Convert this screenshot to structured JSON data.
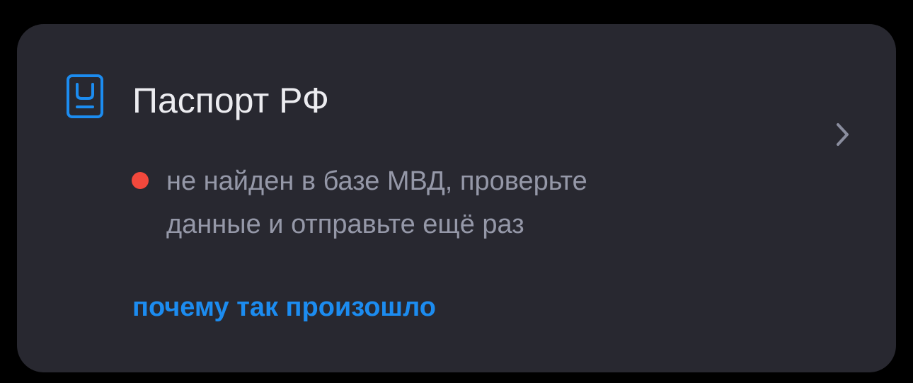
{
  "document_card": {
    "icon": "passport-icon",
    "title": "Паспорт РФ",
    "status": {
      "color": "#F2483C",
      "line1": "не найден в базе МВД, проверьте",
      "line2": "данные и отправьте ещё раз"
    },
    "link_label": "почему так произошло",
    "chevron_icon": "chevron-right-icon"
  },
  "colors": {
    "background": "#000000",
    "card": "#282830",
    "title": "#ECECF0",
    "status_text": "#9598A8",
    "accent": "#1C8CF0",
    "error": "#F2483C",
    "chevron": "#8A8D9E"
  }
}
